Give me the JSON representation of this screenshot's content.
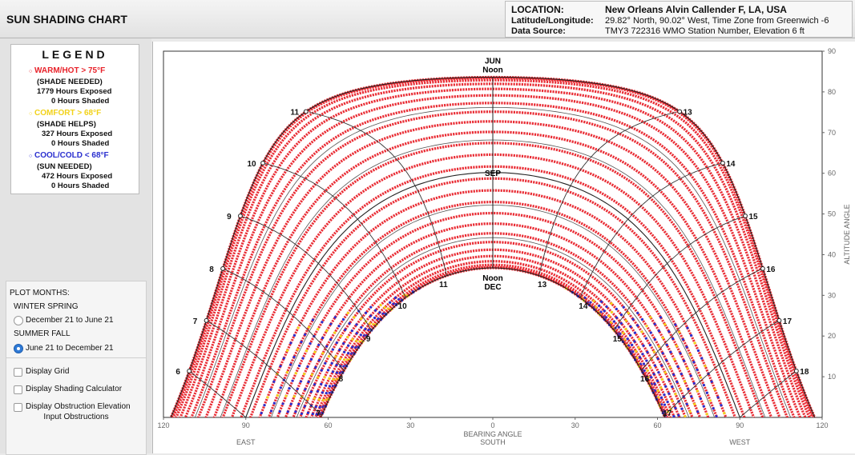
{
  "header": {
    "title": "SUN SHADING CHART",
    "location_label": "LOCATION:",
    "location_value": "New Orleans Alvin Callender F, LA, USA",
    "latlon_label": "Latitude/Longitude:",
    "latlon_value": "29.82° North, 90.02° West, Time Zone from Greenwich -6",
    "source_label": "Data Source:",
    "source_value": "TMY3     722316 WMO Station Number, Elevation 6 ft"
  },
  "legend": {
    "title": "LEGEND",
    "items": [
      {
        "label": "WARM/HOT  > 75°F",
        "color": "#e8222a",
        "note": "(SHADE NEEDED)",
        "exposed": "1779 Hours Exposed",
        "shaded": "0 Hours Shaded"
      },
      {
        "label": "COMFORT  > 68°F",
        "color": "#f2d21a",
        "note": "(SHADE HELPS)",
        "exposed": "327 Hours Exposed",
        "shaded": "0 Hours Shaded"
      },
      {
        "label": "COOL/COLD  < 68°F",
        "color": "#2a2fcf",
        "note": "(SUN NEEDED)",
        "exposed": "472 Hours Exposed",
        "shaded": "0 Hours Shaded"
      }
    ]
  },
  "plot_months": {
    "title": "PLOT MONTHS:",
    "group1": "WINTER SPRING",
    "option1": "December 21 to June 21",
    "group2": "SUMMER FALL",
    "option2": "June 21 to December 21",
    "selected": "option2"
  },
  "options": {
    "display_grid": "Display Grid",
    "shading_calculator": "Display Shading Calculator",
    "obstruction_elevation": "Display Obstruction Elevation",
    "input_obstructions": "Input Obstructions"
  },
  "chart_data": {
    "type": "scatter",
    "title": "",
    "xlabel": "BEARING ANGLE",
    "xlabel_sub": "SOUTH",
    "east_label": "EAST",
    "west_label": "WEST",
    "ylabel": "ALTITUDE ANGLE",
    "xlim": [
      -120,
      120
    ],
    "ylim": [
      0,
      90
    ],
    "x_ticks": [
      "120",
      "90",
      "60",
      "30",
      "0",
      "30",
      "60",
      "90",
      "120"
    ],
    "y_ticks": [
      "10",
      "20",
      "30",
      "40",
      "50",
      "60",
      "70",
      "80",
      "90"
    ],
    "latitude_deg": 29.82,
    "season_arcs": [
      {
        "label": "JUN",
        "sub": "Noon",
        "declination": 23.44
      },
      {
        "label": "SEP",
        "declination": 0
      },
      {
        "label": "DEC",
        "sub": "Noon",
        "declination": -23.44
      }
    ],
    "summer_hour_labels": [
      "6",
      "7",
      "8",
      "9",
      "10",
      "11",
      "13",
      "14",
      "15",
      "16",
      "17",
      "18"
    ],
    "winter_hour_labels": [
      "7",
      "8",
      "9",
      "10",
      "11",
      "13",
      "14",
      "15",
      "16",
      "17"
    ],
    "daily_paths": {
      "count": 26,
      "from": "June 21",
      "to": "December 21"
    },
    "series": [
      {
        "name": "WARM/HOT > 75°F",
        "color": "#e8222a",
        "hours_exposed": 1779,
        "hours_shaded": 0
      },
      {
        "name": "COMFORT > 68°F",
        "color": "#f2d21a",
        "hours_exposed": 327,
        "hours_shaded": 0
      },
      {
        "name": "COOL/COLD < 68°F",
        "color": "#2a2fcf",
        "hours_exposed": 472,
        "hours_shaded": 0
      }
    ],
    "grid": true
  }
}
